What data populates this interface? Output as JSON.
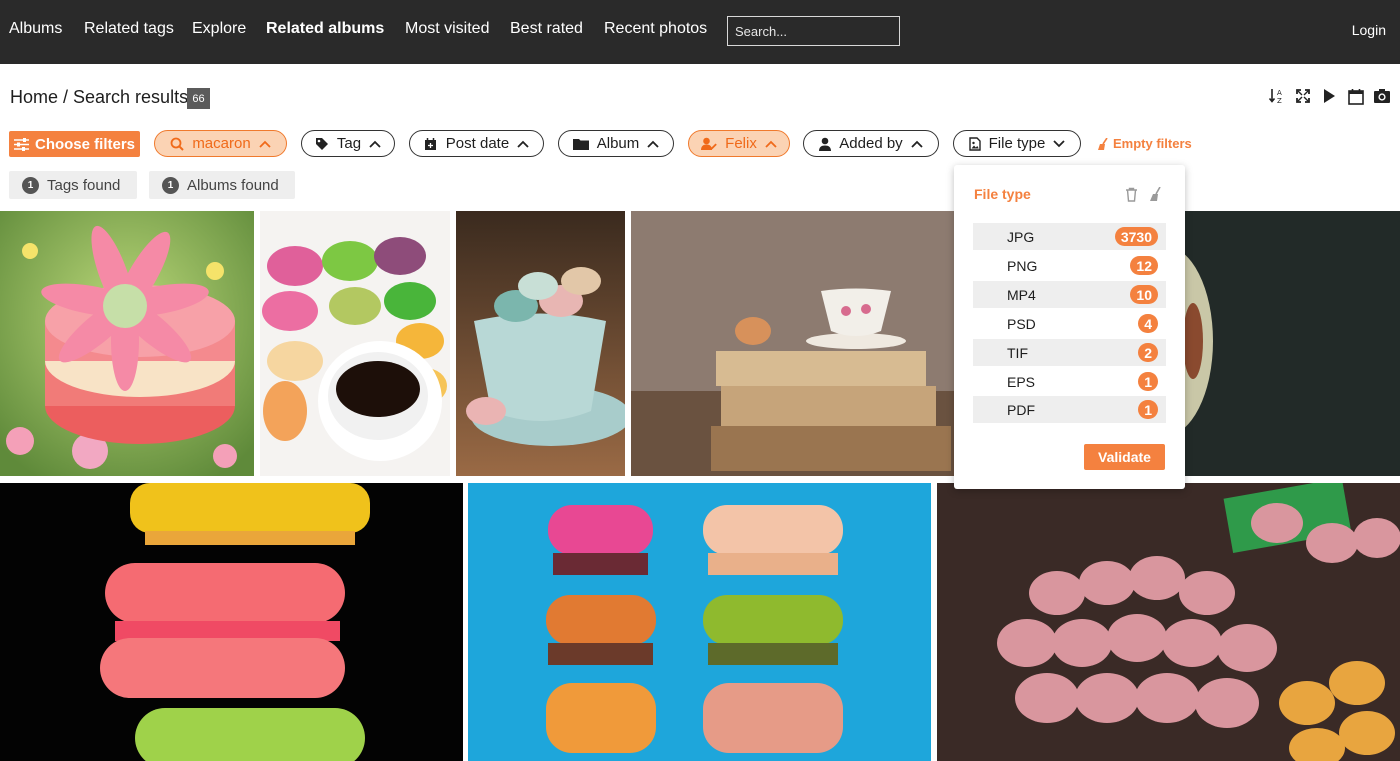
{
  "nav": {
    "items": [
      {
        "label": "Albums"
      },
      {
        "label": "Related tags"
      },
      {
        "label": "Explore"
      },
      {
        "label": "Related albums"
      },
      {
        "label": "Most visited"
      },
      {
        "label": "Best rated"
      },
      {
        "label": "Recent photos"
      }
    ],
    "search_placeholder": "Search...",
    "login": "Login"
  },
  "breadcrumb": {
    "text": "Home / Search results",
    "count": "66"
  },
  "toolbar_icons": [
    "sort-icon",
    "fullscreen-icon",
    "play-icon",
    "calendar-icon",
    "camera-icon"
  ],
  "filters": {
    "choose_label": "Choose filters",
    "chips": [
      {
        "label": "macaron",
        "icon": "search-icon",
        "active": true
      },
      {
        "label": "Tag",
        "icon": "tag-icon",
        "active": false
      },
      {
        "label": "Post date",
        "icon": "calendar-plus-icon",
        "active": false
      },
      {
        "label": "Album",
        "icon": "folder-icon",
        "active": false
      },
      {
        "label": "Felix",
        "icon": "user-edit-icon",
        "active": true
      },
      {
        "label": "Added by",
        "icon": "user-icon",
        "active": false
      },
      {
        "label": "File type",
        "icon": "file-image-icon",
        "active": false
      }
    ],
    "empty_label": "Empty filters"
  },
  "found": {
    "tags": {
      "count": "1",
      "label": "Tags found"
    },
    "albums": {
      "count": "1",
      "label": "Albums found"
    }
  },
  "file_type_dropdown": {
    "title": "File type",
    "options": [
      {
        "label": "JPG",
        "count": "3730"
      },
      {
        "label": "PNG",
        "count": "12"
      },
      {
        "label": "MP4",
        "count": "10"
      },
      {
        "label": "PSD",
        "count": "4"
      },
      {
        "label": "TIF",
        "count": "2"
      },
      {
        "label": "EPS",
        "count": "1"
      },
      {
        "label": "PDF",
        "count": "1"
      }
    ],
    "validate_label": "Validate"
  },
  "colors": {
    "accent": "#f4813f",
    "topbar": "#2a2a2a",
    "active_chip_bg": "#fbd3b4"
  }
}
